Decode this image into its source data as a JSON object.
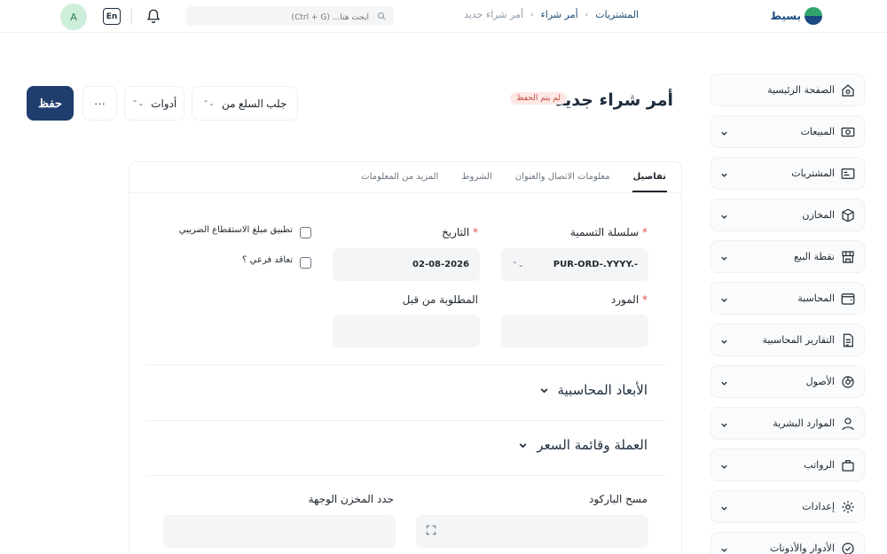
{
  "topbar": {
    "avatar_initial": "A",
    "lang_label": "En",
    "search_placeholder": "ابحث هنا... (Ctrl + G)",
    "brand": "بسيط",
    "breadcrumbs": [
      "المشتريات",
      "أمر شراء",
      "أمر شراء جديد"
    ]
  },
  "page": {
    "title": "أمر شراء جديد",
    "status_badge": "لم يتم الحفظ",
    "save_label": "حفظ",
    "more_label": "···",
    "tools_label": "أدوات",
    "fetch_label": "جلب السلع من"
  },
  "sidebar": {
    "items": [
      {
        "label": "الصفحة الرئيسية",
        "icon": "home-icon",
        "has_chevron": false
      },
      {
        "label": "المبيعات",
        "icon": "money-icon",
        "has_chevron": true
      },
      {
        "label": "المشتريات",
        "icon": "card-icon",
        "has_chevron": true
      },
      {
        "label": "المخازن",
        "icon": "box-icon",
        "has_chevron": true
      },
      {
        "label": "نقطة البيع",
        "icon": "store-icon",
        "has_chevron": true
      },
      {
        "label": "المحاسبة",
        "icon": "wallet-icon",
        "has_chevron": true
      },
      {
        "label": "التقارير المحاسبية",
        "icon": "report-icon",
        "has_chevron": true
      },
      {
        "label": "الأصول",
        "icon": "asset-icon",
        "has_chevron": true
      },
      {
        "label": "الموارد البشرية",
        "icon": "user-icon",
        "has_chevron": true
      },
      {
        "label": "الرواتب",
        "icon": "bag-icon",
        "has_chevron": true
      },
      {
        "label": "إعدادات",
        "icon": "gear-icon",
        "has_chevron": true
      },
      {
        "label": "الأدوار والأذونات",
        "icon": "shield-check-icon",
        "has_chevron": true
      }
    ]
  },
  "tabs": [
    "تفاصيل",
    "معلومات الاتصال والعنوان",
    "الشروط",
    "المزيد من المعلومات"
  ],
  "form": {
    "naming_series": {
      "label": "سلسلة التسمية",
      "value": "PUR-ORD-.YYYY.-"
    },
    "date": {
      "label": "التاريخ",
      "value": "02-08-2026"
    },
    "supplier": {
      "label": "المورد",
      "value": ""
    },
    "required_by": {
      "label": "المطلوبة من قبل",
      "value": ""
    },
    "apply_tds": {
      "label": "تطبيق مبلغ الاستقطاع الضريبي"
    },
    "is_subcontracted": {
      "label": "تعاقد فرعي ؟"
    },
    "section_dimensions": "الأبعاد المحاسبية",
    "section_currency": "العملة وقائمة السعر",
    "scan_barcode": {
      "label": "مسح الباركود",
      "value": ""
    },
    "set_warehouse": {
      "label": "حدد المخزن الوجهة",
      "value": ""
    }
  },
  "colors": {
    "primary": "#1f3e6e",
    "badge_bg": "#fde8e6",
    "badge_text": "#c64a3d",
    "required": "#e24c4c"
  }
}
